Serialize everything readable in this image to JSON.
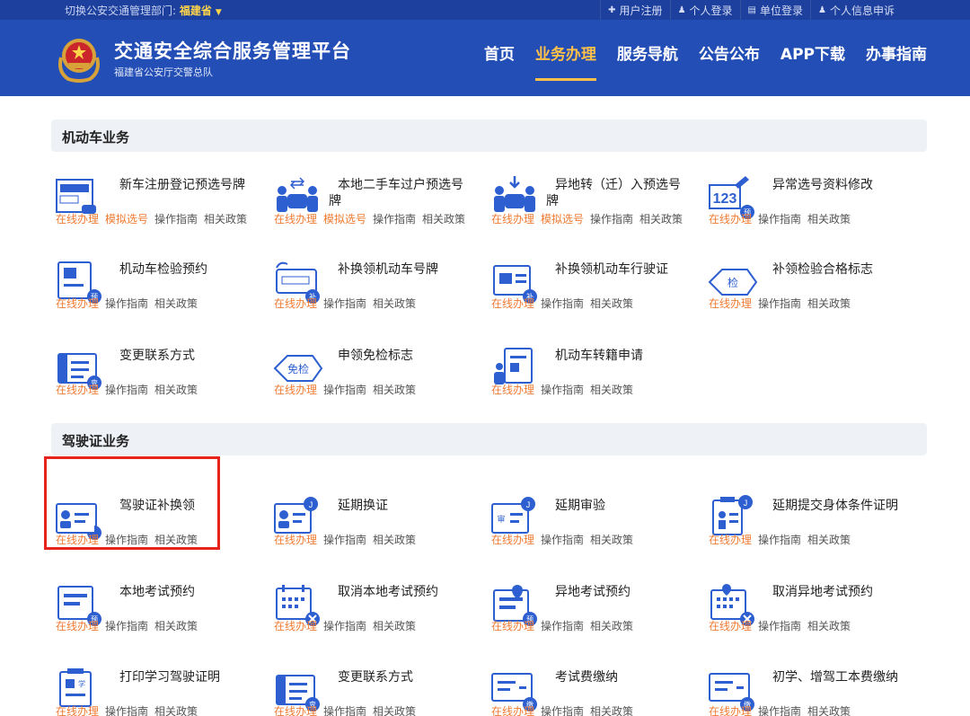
{
  "topbar": {
    "switch_label": "切换公安交通管理部门:",
    "province": "福建省",
    "links": [
      {
        "icon": "plus-icon",
        "label": "用户注册"
      },
      {
        "icon": "person-icon",
        "label": "个人登录"
      },
      {
        "icon": "building-icon",
        "label": "单位登录"
      },
      {
        "icon": "person-icon",
        "label": "个人信息申诉"
      }
    ]
  },
  "header": {
    "title": "交通安全综合服务管理平台",
    "subtitle": "福建省公安厅交警总队",
    "nav": [
      "首页",
      "业务办理",
      "服务导航",
      "公告公布",
      "APP下载",
      "办事指南"
    ],
    "active_nav": "业务办理"
  },
  "link_labels": {
    "online": "在线办理",
    "simulate": "模拟选号",
    "guide": "操作指南",
    "policy": "相关政策"
  },
  "sections": [
    {
      "title": "机动车业务",
      "items": [
        {
          "title": "新车注册登记预选号牌",
          "icon": "plate-card-icon",
          "simulate": true
        },
        {
          "title": "本地二手车过户预选号牌",
          "icon": "car-transfer-icon",
          "simulate": true
        },
        {
          "title": "异地转（迁）入预选号牌",
          "icon": "car-relocate-icon",
          "simulate": true
        },
        {
          "title": "异常选号资料修改",
          "icon": "number-edit-icon",
          "simulate": false
        },
        {
          "title": "机动车检验预约",
          "icon": "inspection-booking-icon",
          "simulate": false
        },
        {
          "title": "补换领机动车号牌",
          "icon": "plate-replace-icon",
          "simulate": false
        },
        {
          "title": "补换领机动车行驶证",
          "icon": "license-replace-icon",
          "simulate": false
        },
        {
          "title": "补领检验合格标志",
          "icon": "inspection-badge-icon",
          "simulate": false
        },
        {
          "title": "变更联系方式",
          "icon": "contact-change-icon",
          "simulate": false
        },
        {
          "title": "申领免检标志",
          "icon": "exempt-badge-icon",
          "simulate": false
        },
        {
          "title": "机动车转籍申请",
          "icon": "vehicle-transfer-icon",
          "simulate": false
        }
      ]
    },
    {
      "title": "驾驶证业务",
      "items": [
        {
          "title": "驾驶证补换领",
          "icon": "license-card-icon"
        },
        {
          "title": "延期换证",
          "icon": "license-extend-icon"
        },
        {
          "title": "延期审验",
          "icon": "review-extend-icon"
        },
        {
          "title": "延期提交身体条件证明",
          "icon": "health-proof-icon"
        },
        {
          "title": "本地考试预约",
          "icon": "exam-booking-icon"
        },
        {
          "title": "取消本地考试预约",
          "icon": "calendar-cancel-icon"
        },
        {
          "title": "异地考试预约",
          "icon": "remote-exam-icon"
        },
        {
          "title": "取消异地考试预约",
          "icon": "calendar-location-cancel-icon"
        },
        {
          "title": "打印学习驾驶证明",
          "icon": "study-print-icon"
        },
        {
          "title": "变更联系方式",
          "icon": "contact-change-icon"
        },
        {
          "title": "考试费缴纳",
          "icon": "fee-pay-icon"
        },
        {
          "title": "初学、增驾工本费缴纳",
          "icon": "fee-pay-icon"
        }
      ]
    }
  ],
  "colors": {
    "header_blue": "#234eb5",
    "topbar_blue": "#1d3f9d",
    "accent_orange": "#ef7a32",
    "nav_active": "#ffc04a",
    "icon_blue": "#2d5fd0",
    "highlight_red": "#e8231b"
  }
}
